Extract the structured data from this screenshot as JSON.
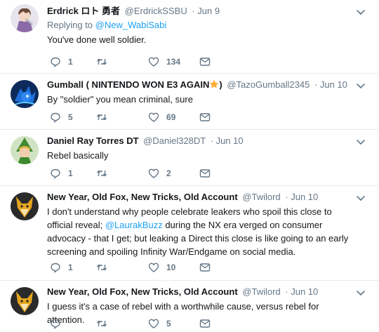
{
  "tweets": [
    {
      "name": "Erdrick ロト 勇者",
      "handle": "@ErdrickSSBU",
      "time": "· Jun 9",
      "reply_prefix": "Replying to ",
      "reply_mention": "@New_WabiSabi",
      "text": "You've done well soldier.",
      "replies": "1",
      "retweets": "",
      "likes": "134",
      "avatar": "anime-character-avatar"
    },
    {
      "name": "Gumball ( NINTENDO WON E3 AGAIN",
      "name_suffix": ")",
      "emoji": "star-emoji",
      "handle": "@TazoGumball2345",
      "time": "· Jun 10",
      "text": "By \"soldier\" you mean criminal, sure",
      "replies": "5",
      "retweets": "",
      "likes": "69",
      "avatar": "blue-sonic-avatar"
    },
    {
      "name": "Daniel Ray Torres DT",
      "handle": "@Daniel328DT",
      "time": "· Jun 10",
      "text": "Rebel basically",
      "replies": "1",
      "retweets": "",
      "likes": "2",
      "avatar": "link-avatar"
    },
    {
      "name": "New Year, Old Fox, New Tricks, Old Account",
      "handle": "@Twilord",
      "time": "· Jun 10",
      "text_before": "I don't understand why people celebrate leakers who spoil this close to official reveal; ",
      "text_mention": "@LaurakBuzz",
      "text_after": " during the NX era verged on consumer advocacy - that I get; but leaking a Direct this close is like going to an early screening and spoiling Infinity War/Endgame on social media.",
      "replies": "1",
      "retweets": "",
      "likes": "10",
      "avatar": "fox-avatar"
    },
    {
      "name": "New Year, Old Fox, New Tricks, Old Account",
      "handle": "@Twilord",
      "time": "· Jun 10",
      "text": "I guess it's a case of rebel with a worthwhile cause, versus rebel for attention.",
      "replies": "",
      "retweets": "",
      "likes": "5",
      "avatar": "fox-avatar"
    }
  ],
  "colors": {
    "text": "#14171a",
    "meta": "#657786",
    "link": "#1da1f2",
    "divider": "#e6ecf0"
  }
}
